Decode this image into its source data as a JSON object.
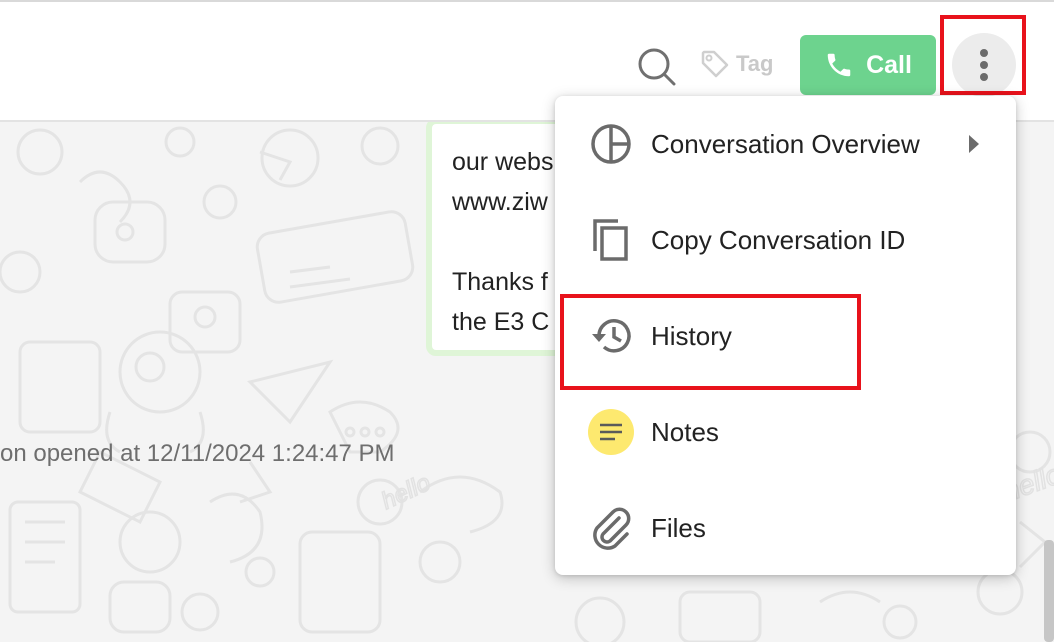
{
  "header": {
    "tag_label": "Tag",
    "call_label": "Call",
    "icons": {
      "search": "search-icon",
      "tag": "tag-icon",
      "phone": "phone-icon",
      "more": "more-vertical-icon"
    }
  },
  "chat": {
    "message_lines": [
      "our webs",
      "www.ziw",
      "",
      "Thanks f",
      "the E3 C"
    ],
    "system_text": "on opened at 12/11/2024 1:24:47 PM"
  },
  "menu": {
    "items": [
      {
        "label": "Conversation Overview",
        "icon": "pie-chart-icon",
        "has_submenu": true
      },
      {
        "label": "Copy Conversation ID",
        "icon": "copy-icon"
      },
      {
        "label": "History",
        "icon": "history-icon"
      },
      {
        "label": "Notes",
        "icon": "notes-icon"
      },
      {
        "label": "Files",
        "icon": "paperclip-icon"
      }
    ]
  },
  "colors": {
    "call_button": "#6dd38e",
    "highlight": "#e8121b",
    "notes_icon_bg": "#fde96f",
    "bubble_border": "#dff5d7"
  }
}
